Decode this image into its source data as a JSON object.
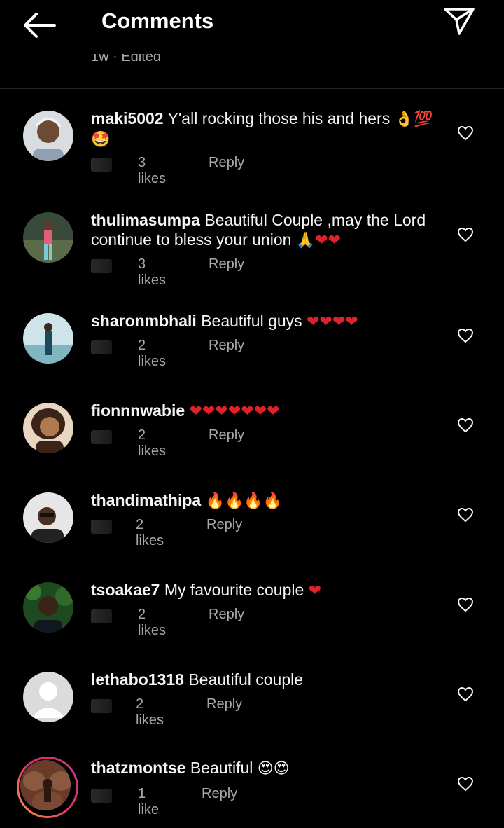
{
  "header": {
    "title": "Comments",
    "back_icon": "arrow-left-icon",
    "share_icon": "paper-plane-icon",
    "edited_text": "1w · Edited"
  },
  "comments": [
    {
      "username": "maki5002",
      "text": "Y'all rocking those his and hers",
      "emoji": "👌💯🤩",
      "likes": "3 likes",
      "reply": "Reply"
    },
    {
      "username": "thulimasumpa",
      "text": "Beautiful Couple ,may the Lord continue to bless your union",
      "emoji": "🙏❤❤",
      "likes": "3 likes",
      "reply": "Reply"
    },
    {
      "username": "sharonmbhali",
      "text": "Beautiful guys",
      "emoji": "❤❤❤❤",
      "likes": "2 likes",
      "reply": "Reply"
    },
    {
      "username": "fionnnwabie",
      "text": "",
      "emoji": "❤❤❤❤❤❤❤",
      "likes": "2 likes",
      "reply": "Reply"
    },
    {
      "username": "thandimathipa",
      "text": "",
      "emoji": "🔥🔥🔥🔥",
      "likes": "2 likes",
      "reply": "Reply"
    },
    {
      "username": "tsoakae7",
      "text": "My favourite couple",
      "emoji": "❤",
      "likes": "2 likes",
      "reply": "Reply"
    },
    {
      "username": "lethabo1318",
      "text": "Beautiful couple",
      "emoji": "",
      "likes": "2 likes",
      "reply": "Reply"
    },
    {
      "username": "thatzmontse",
      "text": "Beautiful",
      "emoji": "😍😍",
      "likes": "1 like",
      "reply": "Reply"
    }
  ],
  "colors": {
    "background": "#000000",
    "text": "#f5f5f5",
    "muted": "#a8a8a8",
    "heart_emoji": "#e0212b",
    "story_ring": "#e1306c"
  }
}
